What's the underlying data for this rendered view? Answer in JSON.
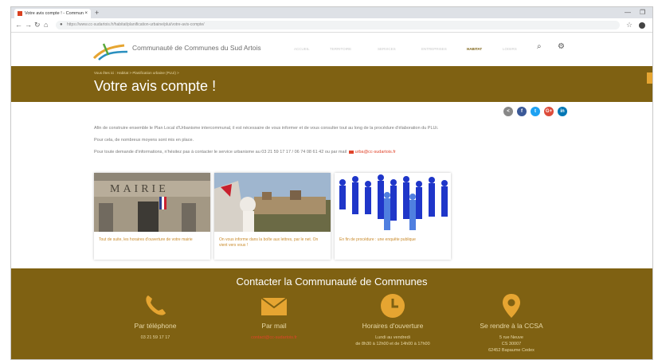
{
  "browser": {
    "tab_title": "Votre avis compte ! - Commun",
    "tab_close": "×",
    "new_tab": "+",
    "url": "https://www.cc-sudartois.fr/habitat/planification-urbaine/plui/votre-avis-compte/",
    "window_minimize": "—",
    "window_restore": "❐",
    "nav": {
      "back": "←",
      "forward": "→",
      "reload": "↻",
      "home": "⌂"
    },
    "lock": "🔒",
    "star": "☆"
  },
  "header": {
    "brand": "Communauté de Communes du Sud Artois",
    "nav_items": [
      "ACCUEIL",
      "TERRITOIRE",
      "SERVICES",
      "ENTREPRISES",
      "HABITAT",
      "LOISIRS"
    ],
    "active_item": "HABITAT",
    "search_icon": "⌕",
    "user_icon": "⚙"
  },
  "title_band": {
    "breadcrumb": "Vous êtes ici : Habitat > Planification urbaine (PLUi) >",
    "title": "Votre avis compte !"
  },
  "share_buttons": [
    {
      "name": "share",
      "label": "<",
      "color": "#888888"
    },
    {
      "name": "facebook",
      "label": "f",
      "color": "#3b5998"
    },
    {
      "name": "twitter",
      "label": "t",
      "color": "#1da1f2"
    },
    {
      "name": "google-plus",
      "label": "G+",
      "color": "#dd4b39"
    },
    {
      "name": "linkedin",
      "label": "in",
      "color": "#0077b5"
    }
  ],
  "content": {
    "paragraph1": "Afin de construire ensemble le Plan Local d'Urbanisme intercommunal, il est nécessaire de vous informer et de vous consulter tout au long de la procédure d'élaboration du PLUi.",
    "paragraph2": "Pour cela, de nombreux moyens sont mis en place.",
    "paragraph3": "Pour toute demande d'informations, n'hésitez pas à contacter le service urbanisme au 03 21 59 17 17 / 06 74 08 61 42 ou par mail",
    "email": "urba@cc-sudartois.fr"
  },
  "cards": [
    {
      "image": "mairie",
      "text": "Tout de suite, les horaires d'ouverture de votre mairie"
    },
    {
      "image": "paysage",
      "text": "On vous informe dans la boîte aux lettres, par le net. On vient vers vous !"
    },
    {
      "image": "public",
      "text": "En fin de procédure : une enquête publique"
    }
  ],
  "card_images": {
    "mairie_sign": "MAIRIE"
  },
  "footer": {
    "title": "Contacter la Communauté de Communes",
    "columns": [
      {
        "icon": "phone-icon",
        "label": "Par téléphone",
        "value": "03 21 59 17 17",
        "link": false
      },
      {
        "icon": "envelope-icon",
        "label": "Par mail",
        "value": "contact@cc-sudartois.fr",
        "link": true
      },
      {
        "icon": "clock-icon",
        "label": "Horaires d'ouverture",
        "value": "Lundi au vendredi",
        "value2": "de 8h30 à 12h00 et de 14h00 à 17h00",
        "link": false
      },
      {
        "icon": "map-pin-icon",
        "label": "Se rendre à la CCSA",
        "value": "5 rue Neuve",
        "value2": "CS 30007",
        "value3": "62452 Bapaume Cedex",
        "link": false
      }
    ]
  },
  "colors": {
    "brand_brown": "#7f6112",
    "accent_orange": "#e6a531",
    "link_red": "#e0442b"
  }
}
